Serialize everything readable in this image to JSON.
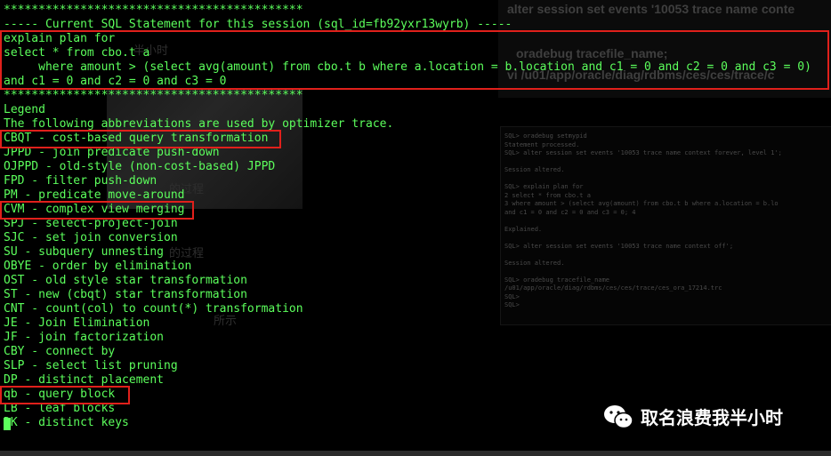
{
  "terminal": {
    "lines": [
      "*******************************************",
      "----- Current SQL Statement for this session (sql_id=fb92yxr13wyrb) -----",
      "explain plan for",
      "select * from cbo.t a",
      "     where amount > (select avg(amount) from cbo.t b where a.location = b.location and c1 = 0 and c2 = 0 and c3 = 0)",
      "and c1 = 0 and c2 = 0 and c3 = 0",
      "*******************************************",
      "Legend",
      "The following abbreviations are used by optimizer trace.",
      "CBQT - cost-based query transformation",
      "JPPD - join predicate push-down",
      "OJPPD - old-style (non-cost-based) JPPD",
      "FPD - filter push-down",
      "PM - predicate move-around",
      "CVM - complex view merging",
      "SPJ - select-project-join",
      "SJC - set join conversion",
      "SU - subquery unnesting",
      "OBYE - order by elimination",
      "OST - old style star transformation",
      "ST - new (cbqt) star transformation",
      "CNT - count(col) to count(*) transformation",
      "JE - Join Elimination",
      "JF - join factorization",
      "CBY - connect by",
      "SLP - select list pruning",
      "DP - distinct placement",
      "qb - query block",
      "LB - leaf blocks",
      "DK - distinct keys"
    ]
  },
  "background": {
    "top_right_1": "alter session set events '10053 trace name conte",
    "top_right_2": "oradebug tracefile_name;",
    "top_right_3": "vi /u01/app/oracle/diag/rdbms/ces/ces/trace/c",
    "faint_cn_1": "半小时",
    "faint_cn_2": "的过程",
    "faint_cn_3": "的过程",
    "faint_cn_4": "所示",
    "mini_terminal": [
      "SQL> oradebug setmypid",
      "Statement processed.",
      "SQL> alter session set events '10053 trace name context forever, level 1';",
      "",
      "Session altered.",
      "",
      "SQL> explain plan for",
      "  2  select * from cbo.t a",
      "  3  where amount > (select avg(amount) from cbo.t b where a.location = b.lo",
      "and c1 = 0 and c2 = 0 and c3 = 0;  4",
      "",
      "Explained.",
      "",
      "SQL> alter session set events '10053 trace name context off';",
      "",
      "Session altered.",
      "",
      "SQL> oradebug tracefile_name",
      "/u01/app/oracle/diag/rdbms/ces/ces/trace/ces_ora_17214.trc",
      "SQL>",
      "SQL>"
    ]
  },
  "watermark": {
    "text": "取名浪费我半小时",
    "icon": "wechat-icon"
  },
  "colors": {
    "terminal_text": "#5cff5c",
    "highlight": "#e0201b",
    "background": "#000000"
  }
}
